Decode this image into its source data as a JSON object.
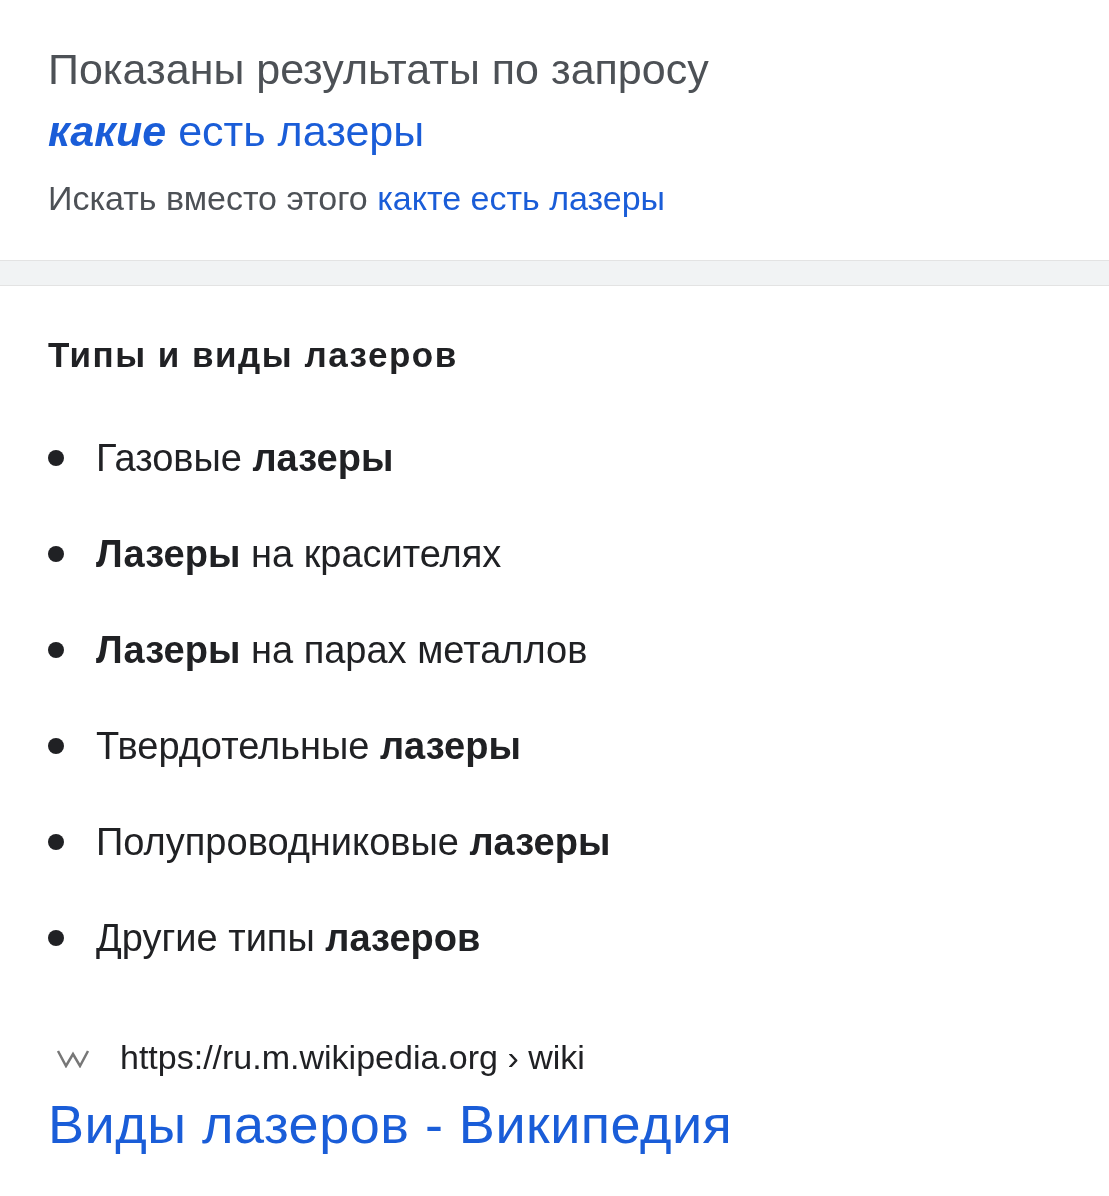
{
  "correction": {
    "prefix": "Показаны результаты по запросу",
    "corrected_query": "**какие** есть лазеры",
    "alt_prefix": "Искать вместо этого",
    "original_query": "какте есть лазеры"
  },
  "featured": {
    "heading": "Типы и виды лазеров",
    "items": [
      "Газовые **лазеры**",
      "**Лазеры** на красителях",
      "**Лазеры** на парах металлов",
      "Твердотельные **лазеры**",
      "Полупроводниковые **лазеры**",
      "Другие типы **лазеров**"
    ]
  },
  "result": {
    "url": "https://ru.m.wikipedia.org › wiki",
    "title": "Виды лазеров - Википедия"
  }
}
